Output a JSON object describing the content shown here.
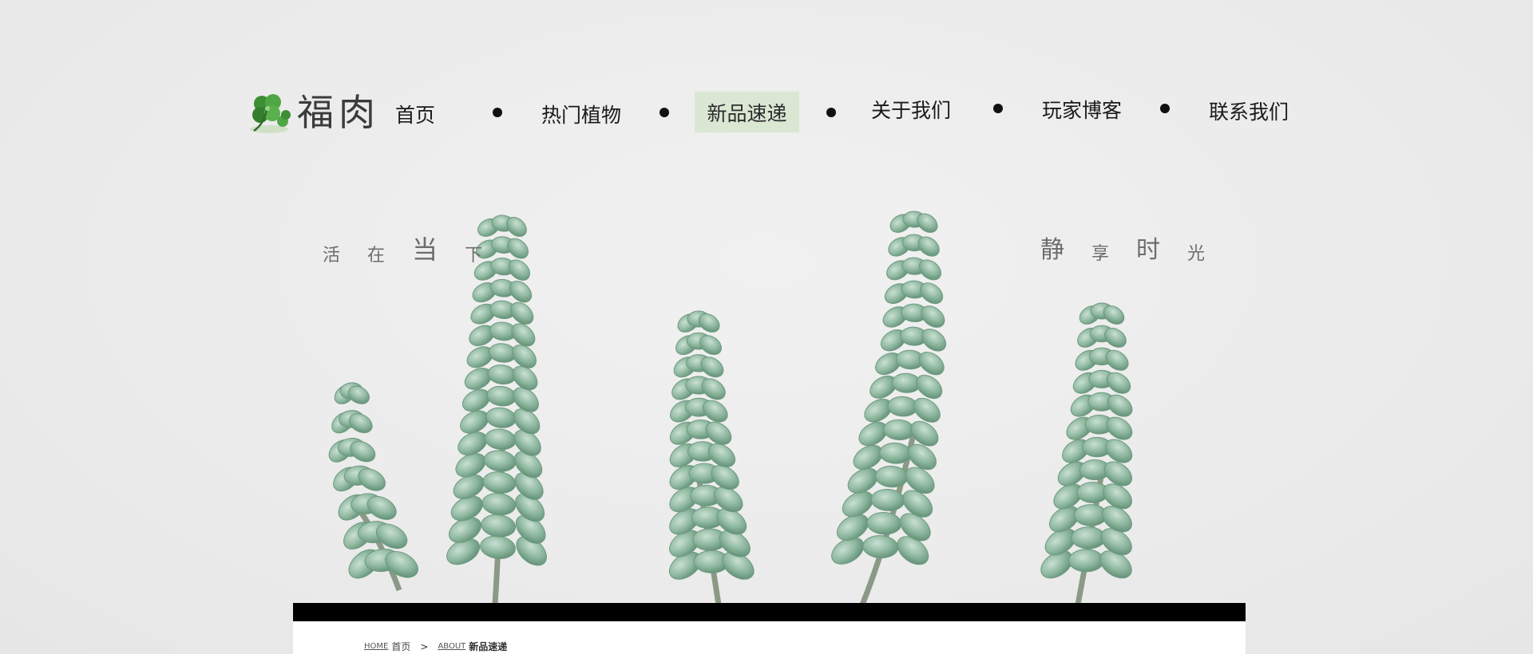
{
  "logo": {
    "text": "福肉",
    "icon": "clover-icon",
    "accent": "#3f9a3a"
  },
  "nav": {
    "items": [
      {
        "label": "首页"
      },
      {
        "label": "热门植物"
      },
      {
        "label": "新品速递",
        "active": true
      },
      {
        "label": "关于我们"
      },
      {
        "label": "玩家博客"
      },
      {
        "label": "联系我们"
      }
    ],
    "active_color": "#d9e7d3"
  },
  "hero": {
    "left_text": [
      "活",
      "在",
      "当",
      "下"
    ],
    "right_text": [
      "静",
      "享",
      "时",
      "光"
    ],
    "image": "succulent-plants-photo"
  },
  "breadcrumb": {
    "home_en": "HOME",
    "home": "首页",
    "separator": ">",
    "section_en": "ABOUT",
    "current": "新品速递"
  }
}
